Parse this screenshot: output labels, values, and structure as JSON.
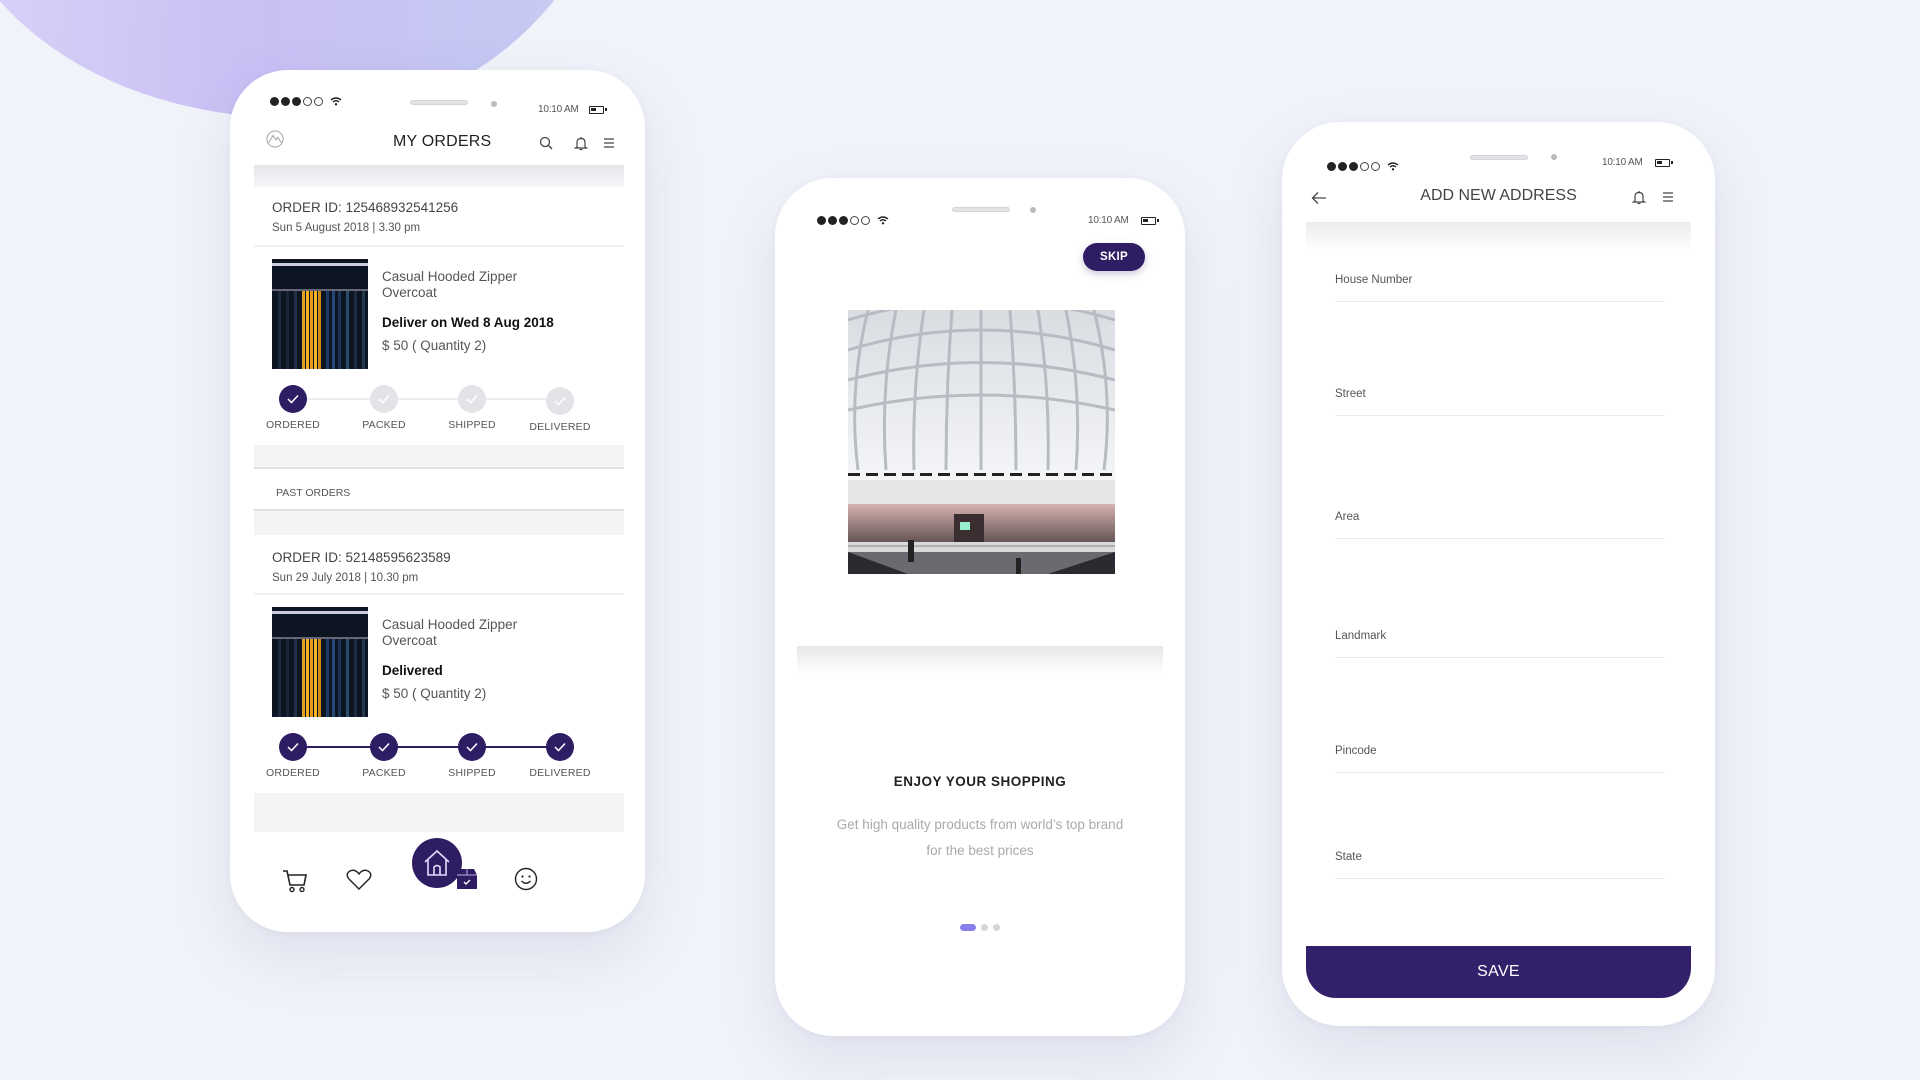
{
  "status_bar": {
    "time": "10:10 AM",
    "signal_filled": 3,
    "signal_total": 5
  },
  "orders_screen": {
    "title": "MY ORDERS",
    "current_order": {
      "order_id": "ORDER ID: 125468932541256",
      "date": "Sun  5 August 2018 | 3.30 pm",
      "product_name": "Casual Hooded Zipper Overcoat",
      "status": "Deliver on Wed 8 Aug 2018",
      "price": "$ 50  ( Quantity 2)",
      "steps": [
        {
          "label": "ORDERED",
          "done": true
        },
        {
          "label": "PACKED",
          "done": false
        },
        {
          "label": "SHIPPED",
          "done": false
        },
        {
          "label": "DELIVERED",
          "done": false
        }
      ]
    },
    "past_orders_label": "PAST ORDERS",
    "past_order": {
      "order_id": "ORDER ID: 52148595623589",
      "date": "Sun  29 July 2018 | 10.30 pm",
      "product_name": "Casual Hooded Zipper Overcoat",
      "status": "Delivered",
      "price": "$ 50  ( Quantity 2)",
      "steps": [
        {
          "label": "ORDERED",
          "done": true
        },
        {
          "label": "PACKED",
          "done": true
        },
        {
          "label": "SHIPPED",
          "done": true
        },
        {
          "label": "DELIVERED",
          "done": true
        }
      ]
    },
    "tabbar": [
      "cart",
      "wishlist",
      "home",
      "orders",
      "profile"
    ]
  },
  "onboarding_screen": {
    "skip_label": "SKIP",
    "title": "ENJOY YOUR SHOPPING",
    "subtitle": "Get high quality products from world’s top brand for the best prices",
    "page_index": 1,
    "page_count": 3
  },
  "address_screen": {
    "title": "ADD NEW ADDRESS",
    "fields": [
      {
        "placeholder": "House Number",
        "value": ""
      },
      {
        "placeholder": "Street",
        "value": ""
      },
      {
        "placeholder": "Area",
        "value": ""
      },
      {
        "placeholder": "Landmark",
        "value": ""
      },
      {
        "placeholder": "Pincode",
        "value": ""
      },
      {
        "placeholder": "State",
        "value": ""
      }
    ],
    "save_label": "SAVE"
  },
  "colors": {
    "brand": "#2e1d63",
    "accent": "#8a7ee8",
    "background": "#f1f3fa"
  }
}
